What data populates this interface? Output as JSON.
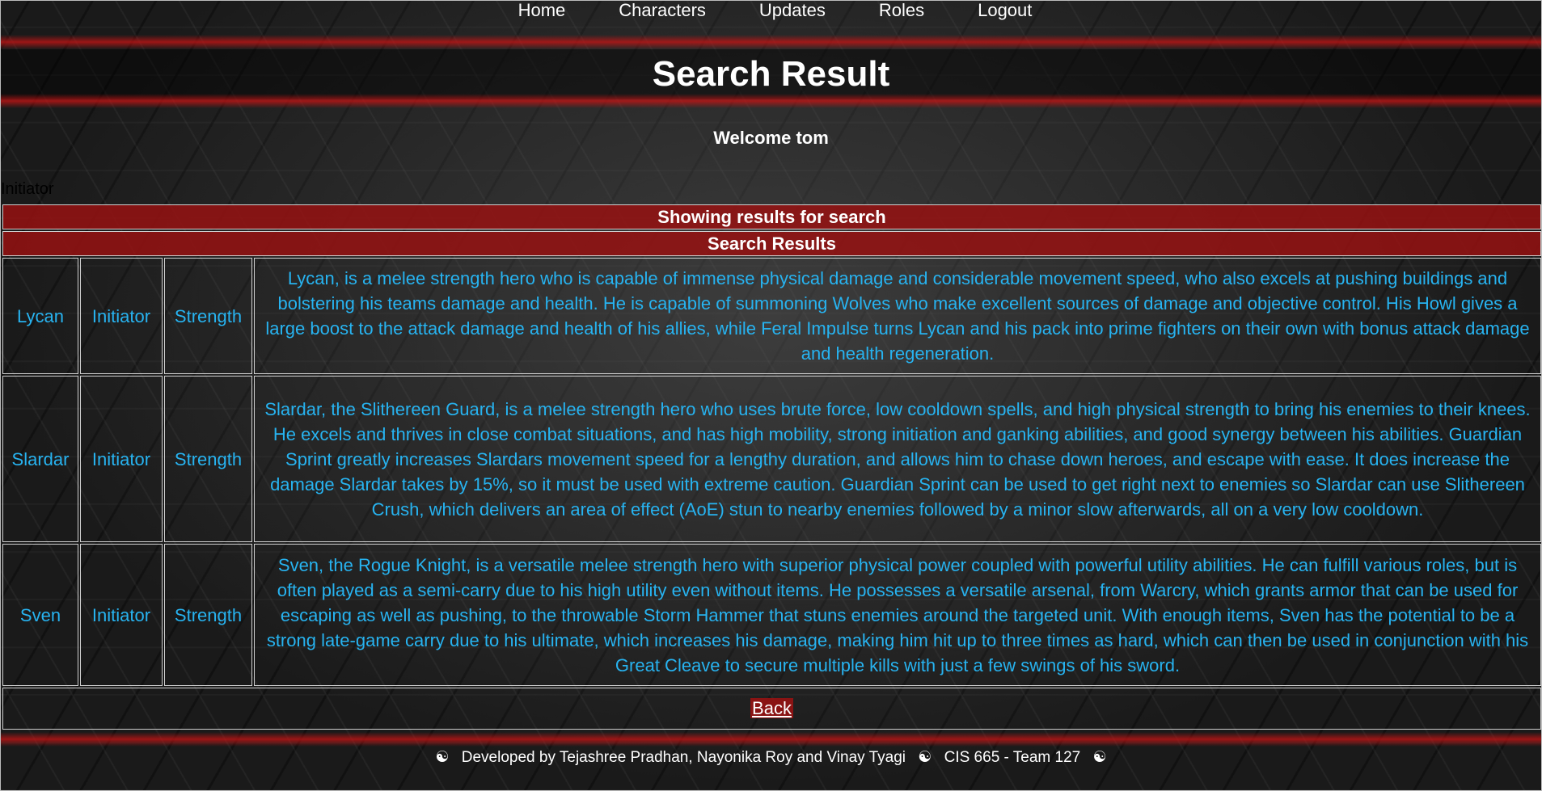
{
  "nav": {
    "items": [
      {
        "label": "Home"
      },
      {
        "label": "Characters"
      },
      {
        "label": "Updates"
      },
      {
        "label": "Roles"
      },
      {
        "label": "Logout"
      }
    ]
  },
  "page": {
    "title": "Search Result",
    "welcome": "Welcome tom",
    "search_term": "Initiator"
  },
  "table": {
    "header1": "Showing results for search",
    "header2": "Search Results",
    "rows": [
      {
        "name": "Lycan",
        "role": "Initiator",
        "attribute": "Strength",
        "description": "Lycan, is a melee strength hero who is capable of immense physical damage and considerable movement speed, who also excels at pushing buildings and bolstering his teams damage and health. He is capable of summoning Wolves who make excellent sources of damage and objective control. His Howl gives a large boost to the attack damage and health of his allies, while Feral Impulse turns Lycan and his pack into prime fighters on their own with bonus attack damage and health regeneration."
      },
      {
        "name": "Slardar",
        "role": "Initiator",
        "attribute": "Strength",
        "description": "Slardar, the Slithereen Guard, is a melee strength hero who uses brute force, low cooldown spells, and high physical strength to bring his enemies to their knees. He excels and thrives in close combat situations, and has high mobility, strong initiation and ganking abilities, and good synergy between his abilities. Guardian Sprint greatly increases Slardars movement speed for a lengthy duration, and allows him to chase down heroes, and escape with ease. It does increase the damage Slardar takes by 15%, so it must be used with extreme caution. Guardian Sprint can be used to get right next to enemies so Slardar can use Slithereen Crush, which delivers an area of effect (AoE) stun to nearby enemies followed by a minor slow afterwards, all on a very low cooldown."
      },
      {
        "name": "Sven",
        "role": "Initiator",
        "attribute": "Strength",
        "description": "Sven, the Rogue Knight, is a versatile melee strength hero with superior physical power coupled with powerful utility abilities. He can fulfill various roles, but is often played as a semi-carry due to his high utility even without items. He possesses a versatile arsenal, from Warcry, which grants armor that can be used for escaping as well as pushing, to the throwable Storm Hammer that stuns enemies around the targeted unit. With enough items, Sven has the potential to be a strong late-game carry due to his ultimate, which increases his damage, making him hit up to three times as hard, which can then be used in conjunction with his Great Cleave to secure multiple kills with just a few swings of his sword."
      }
    ],
    "back_label": "Back"
  },
  "footer": {
    "symbol": "☯",
    "developers": "Developed by Tejashree Pradhan, Nayonika Roy and Vinay Tyagi",
    "course": "CIS 665 - Team 127"
  },
  "colors": {
    "accent_red": "#961212",
    "text_blue": "#27b3f0"
  }
}
